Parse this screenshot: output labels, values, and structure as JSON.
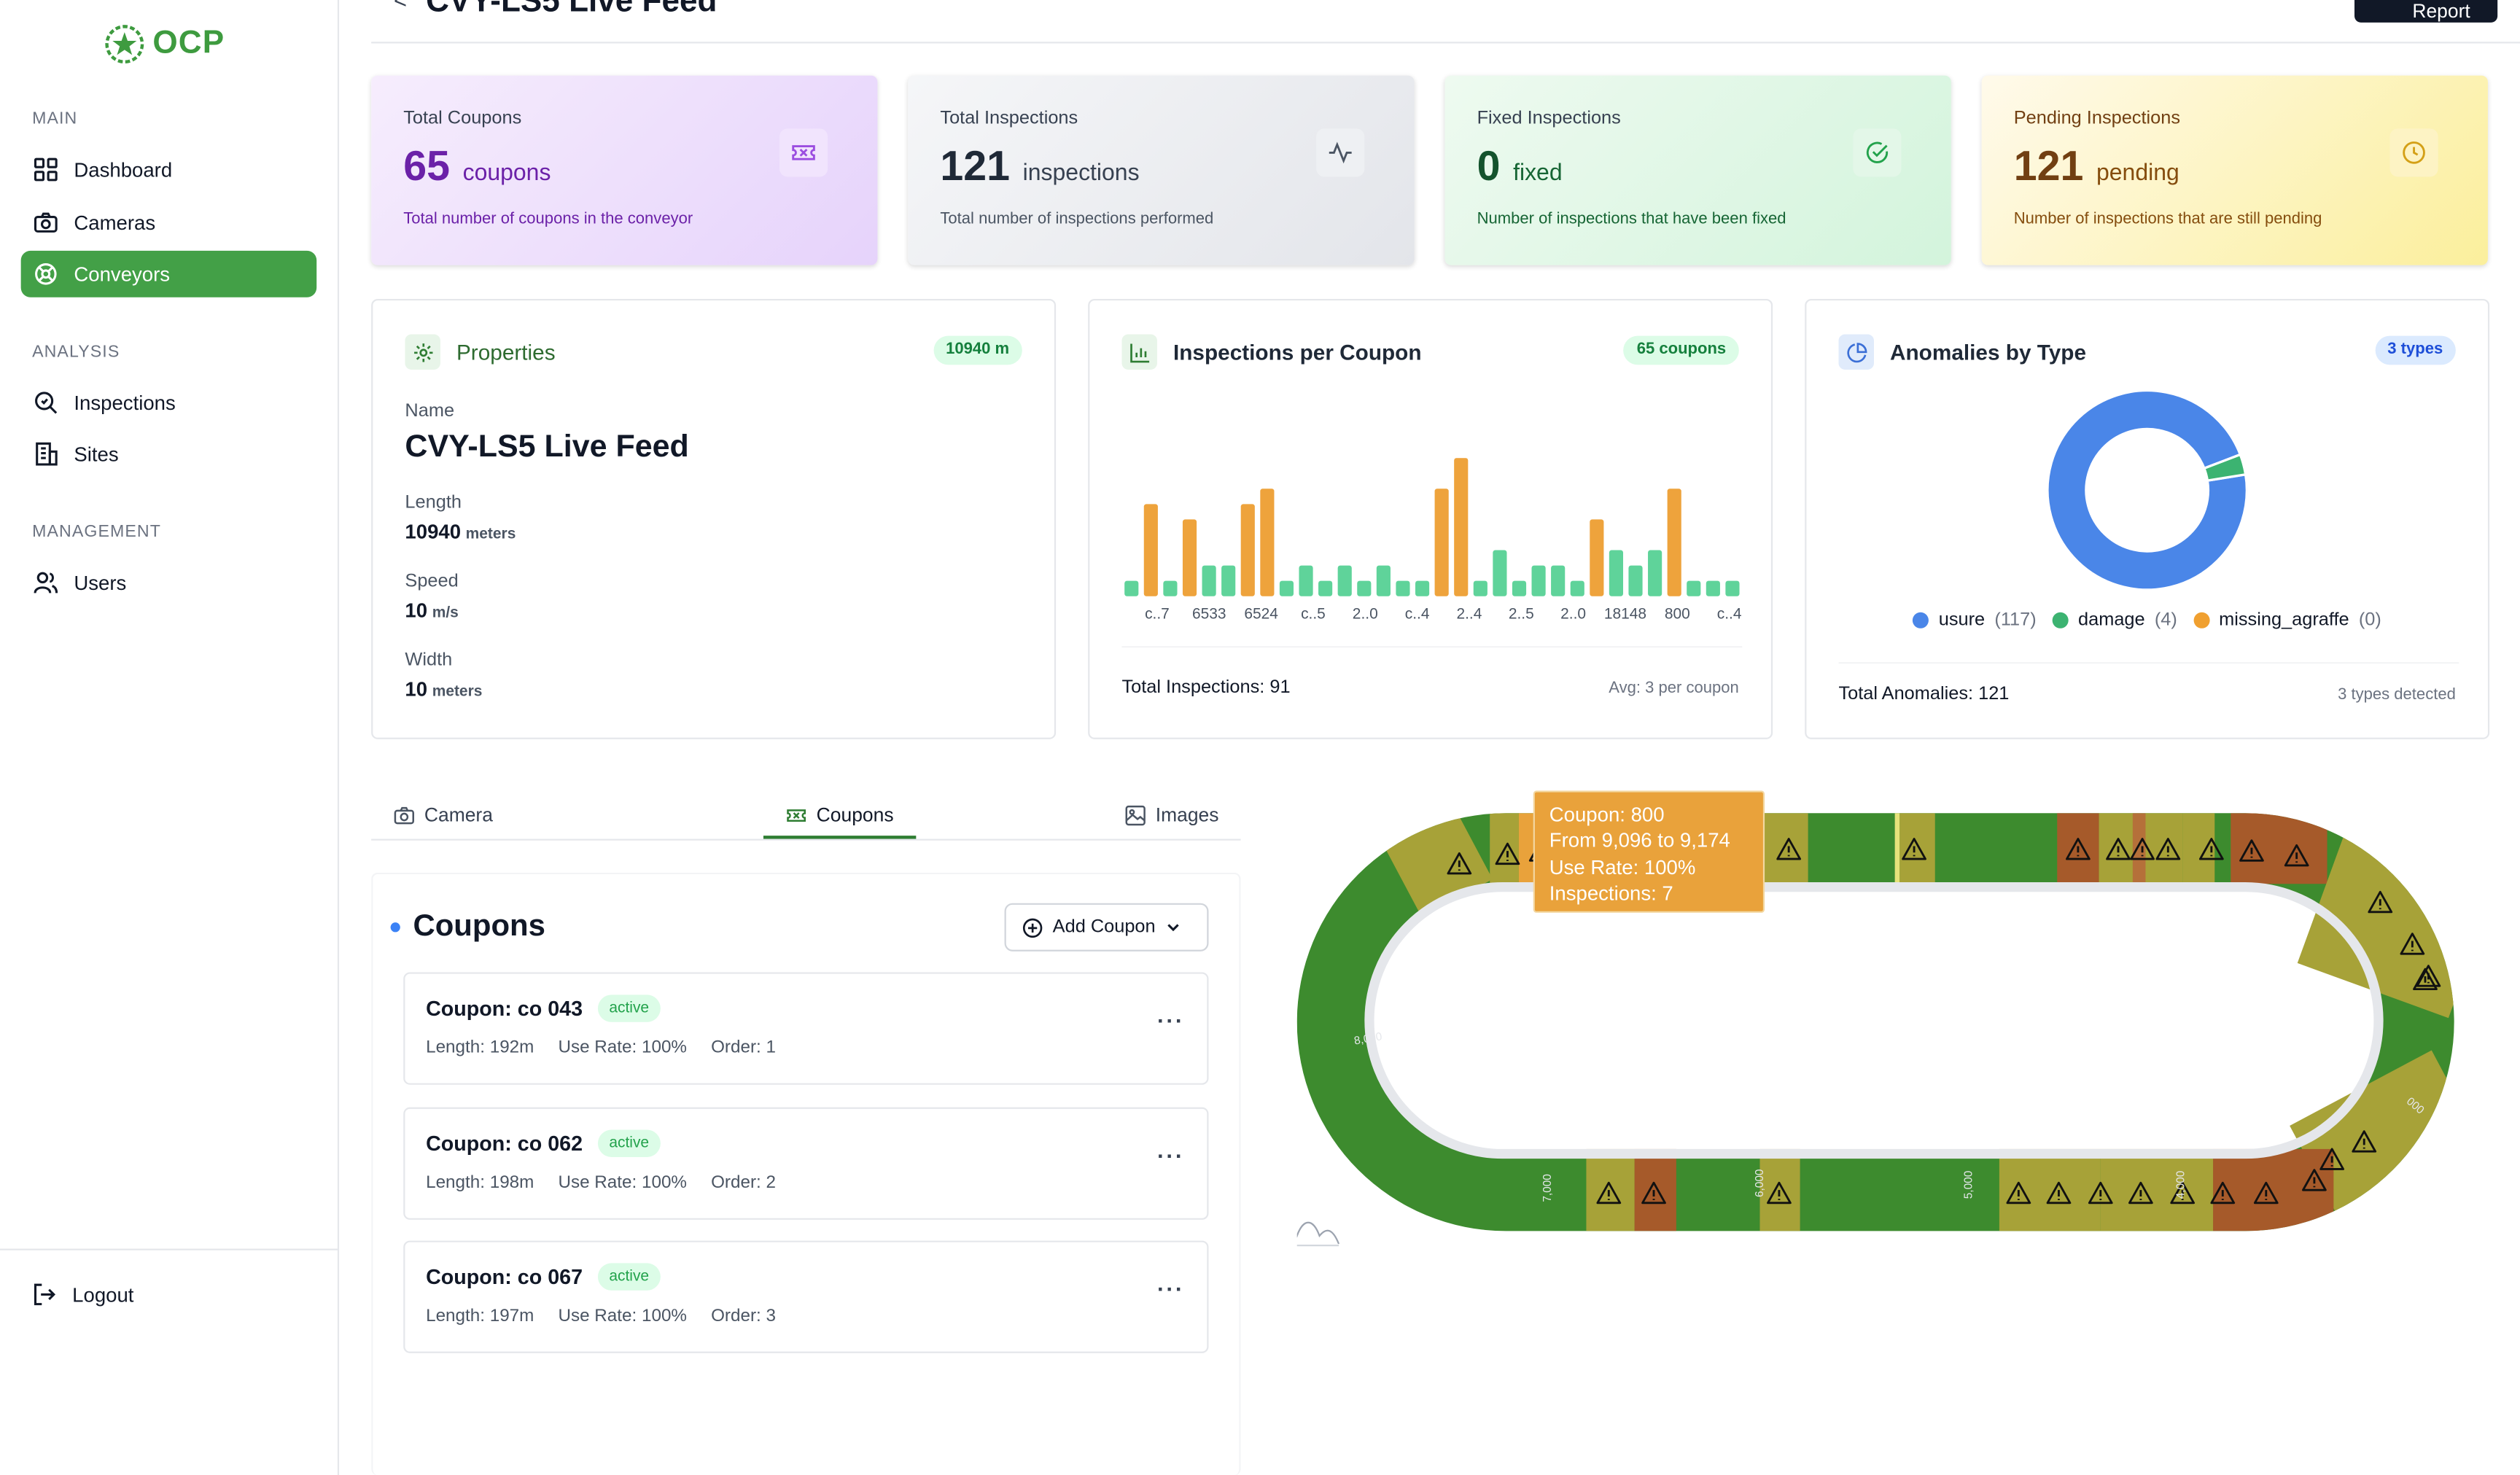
{
  "app": {
    "logo_text": "OCP"
  },
  "sidebar": {
    "sections": {
      "main": "MAIN",
      "analysis": "ANALYSIS",
      "management": "MANAGEMENT"
    },
    "items": [
      {
        "label": "Dashboard",
        "icon": "dashboard-icon"
      },
      {
        "label": "Cameras",
        "icon": "camera-icon"
      },
      {
        "label": "Conveyors",
        "icon": "conveyor-icon",
        "active": true
      },
      {
        "label": "Inspections",
        "icon": "search-icon"
      },
      {
        "label": "Sites",
        "icon": "building-icon"
      },
      {
        "label": "Users",
        "icon": "users-icon"
      }
    ],
    "logout": "Logout"
  },
  "header": {
    "back": "<",
    "title": "CVY-LS5 Live Feed",
    "report_label": "Report"
  },
  "stats": [
    {
      "label": "Total Coupons",
      "value": "65",
      "unit": "coupons",
      "desc": "Total number of coupons in the conveyor",
      "icon": "ticket-icon"
    },
    {
      "label": "Total Inspections",
      "value": "121",
      "unit": "inspections",
      "desc": "Total number of inspections performed",
      "icon": "activity-icon"
    },
    {
      "label": "Fixed Inspections",
      "value": "0",
      "unit": "fixed",
      "desc": "Number of inspections that have been fixed",
      "icon": "check-circle-icon"
    },
    {
      "label": "Pending Inspections",
      "value": "121",
      "unit": "pending",
      "desc": "Number of inspections that are still pending",
      "icon": "clock-icon"
    }
  ],
  "properties": {
    "title": "Properties",
    "badge": "10940 m",
    "name_label": "Name",
    "name": "CVY-LS5 Live Feed",
    "length_label": "Length",
    "length": "10940",
    "length_unit": "meters",
    "speed_label": "Speed",
    "speed": "10",
    "speed_unit": "m/s",
    "width_label": "Width",
    "width": "10",
    "width_unit": "meters"
  },
  "inspections_chart": {
    "title": "Inspections per Coupon",
    "badge": "65 coupons",
    "footer_left": "Total Inspections: 91",
    "footer_right": "Avg: 3 per coupon"
  },
  "anomalies_chart": {
    "title": "Anomalies by Type",
    "badge": "3 types",
    "legend": [
      {
        "name": "usure",
        "count": "(117)",
        "color": "#4a86e8"
      },
      {
        "name": "damage",
        "count": "(4)",
        "color": "#3cb371"
      },
      {
        "name": "missing_agraffe",
        "count": "(0)",
        "color": "#f0a030"
      }
    ],
    "footer_left": "Total Anomalies: 121",
    "footer_right": "3 types detected"
  },
  "chart_data": [
    {
      "type": "bar",
      "title": "Inspections per Coupon",
      "x_tick_labels": [
        "c..7",
        "6533",
        "6524",
        "c..5",
        "2..0",
        "c..4",
        "2..4",
        "2..5",
        "2..0",
        "18148",
        "800",
        "c..4"
      ],
      "values": [
        1,
        6,
        1,
        5,
        2,
        2,
        6,
        7,
        1,
        2,
        1,
        2,
        1,
        2,
        1,
        1,
        7,
        9,
        1,
        3,
        1,
        2,
        2,
        1,
        5,
        3,
        2,
        3,
        7,
        1,
        1,
        1
      ],
      "highlight_indices": [
        1,
        3,
        6,
        7,
        16,
        17,
        24,
        28
      ],
      "colors": {
        "base": "#5fd39a",
        "highlight": "#eea33c"
      }
    },
    {
      "type": "pie",
      "title": "Anomalies by Type",
      "labels": [
        "usure",
        "damage",
        "missing_agraffe"
      ],
      "values": [
        117,
        4,
        0
      ]
    }
  ],
  "tabs": [
    {
      "label": "Camera",
      "icon": "camera-icon"
    },
    {
      "label": "Coupons",
      "icon": "ticket-icon",
      "active": true
    },
    {
      "label": "Images",
      "icon": "image-icon"
    }
  ],
  "coupons_panel": {
    "title": "Coupons",
    "add_label": "Add Coupon",
    "items": [
      {
        "name": "Coupon: co 043",
        "status": "active",
        "length": "Length: 192m",
        "use_rate": "Use Rate: 100%",
        "order": "Order: 1"
      },
      {
        "name": "Coupon: co 062",
        "status": "active",
        "length": "Length: 198m",
        "use_rate": "Use Rate: 100%",
        "order": "Order: 2"
      },
      {
        "name": "Coupon: co 067",
        "status": "active",
        "length": "Length: 197m",
        "use_rate": "Use Rate: 100%",
        "order": "Order: 3"
      }
    ]
  },
  "track": {
    "labels": [
      "8,000",
      "7,000",
      "6,000",
      "5,000",
      "4,000",
      "000"
    ],
    "tooltip": {
      "line1": "Coupon: 800",
      "line2": "From 9,096 to 9,174",
      "line3": "Use Rate: 100%",
      "line4": "Inspections: 7"
    }
  }
}
